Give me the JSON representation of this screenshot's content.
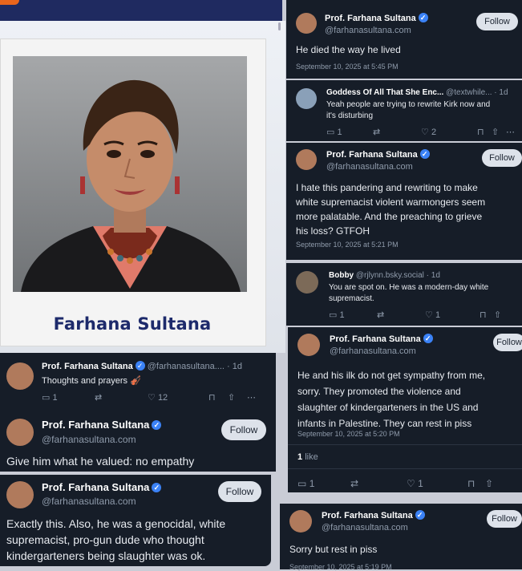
{
  "colors": {
    "card_bg": "#161d28",
    "verified": "#3b82f6",
    "caption": "#1d2a6b",
    "follow_bg": "#dde2ea"
  },
  "profile": {
    "caption": "Farhana Sultana"
  },
  "posts": {
    "p1": {
      "name": "Prof. Farhana Sultana",
      "handle": "@farhanasultana.com",
      "follow": "Follow",
      "text": "He died the way he lived",
      "ts": "September 10, 2025 at 5:45 PM"
    },
    "r1": {
      "name": "Goddess Of All That She Enc...",
      "handle": "@textwhile...",
      "age": "· 1d",
      "text1": "Yeah people are trying to rewrite Kirk now and",
      "text2": "it's disturbing",
      "replies": "1",
      "likes": "2"
    },
    "p2": {
      "name": "Prof. Farhana Sultana",
      "handle": "@farhanasultana.com",
      "follow": "Follow",
      "l1": "I hate this pandering and rewriting to make",
      "l2": "white supremacist violent warmongers seem",
      "l3": "more palatable. And the preaching to grieve",
      "l4": "his loss? GTFOH",
      "ts": "September 10, 2025 at 5:21 PM"
    },
    "r2": {
      "name": "Bobby",
      "handle": "@rjlynn.bsky.social",
      "age": "· 1d",
      "text1": "You are spot on. He was a modern-day white",
      "text2": "supremacist.",
      "replies": "1",
      "likes": "1"
    },
    "p3": {
      "name": "Prof. Farhana Sultana",
      "handle": "@farhanasultana.com",
      "follow": "Follow",
      "l1": "He and his ilk do not get sympathy from me,",
      "l2": "sorry. They promoted the violence and",
      "l3": "slaughter of kindergarteners in the US and",
      "l4": "infants in Palestine. They can rest in piss",
      "ts": "September 10, 2025 at 5:20 PM",
      "likes_num": "1",
      "likes_word": "like",
      "replies": "1",
      "like_count": "1"
    },
    "p4": {
      "name": "Prof. Farhana Sultana",
      "handle": "@farhanasultana.com",
      "follow": "Follow",
      "text": "Sorry but rest in piss",
      "ts": "September 10, 2025 at 5:19 PM"
    },
    "l1": {
      "name": "Prof. Farhana Sultana",
      "handle": "@farhanasultana....",
      "age": "· 1d",
      "text": "Thoughts and prayers 🎻",
      "replies": "1",
      "likes": "12"
    },
    "l2": {
      "name": "Prof. Farhana Sultana",
      "handle": "@farhanasultana.com",
      "follow": "Follow",
      "text": "Give him what he valued: no empathy"
    },
    "l3": {
      "name": "Prof. Farhana Sultana",
      "handle": "@farhanasultana.com",
      "follow": "Follow",
      "l1": "Exactly this. Also, he was a genocidal, white",
      "l2": "supremacist, pro-gun dude who thought",
      "l3": "kindergarteners being slaughter was ok."
    }
  }
}
